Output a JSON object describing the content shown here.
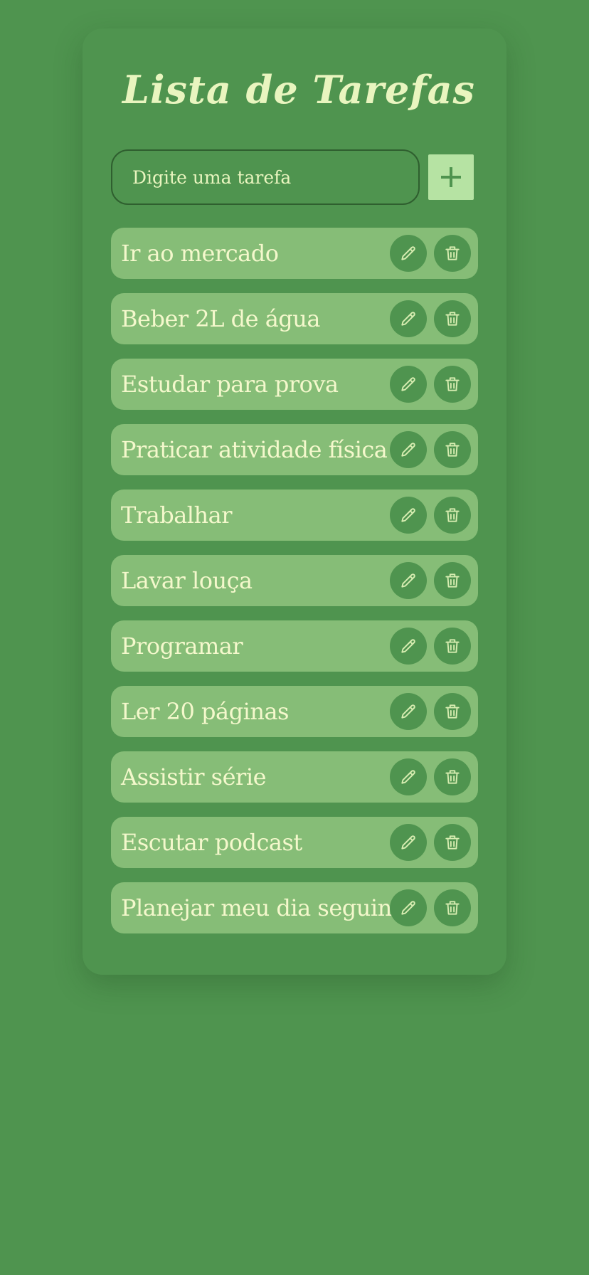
{
  "app": {
    "title": "Lista de Tarefas"
  },
  "input": {
    "placeholder": "Digite uma tarefa",
    "value": ""
  },
  "add_button": {
    "icon": "plus-icon"
  },
  "colors": {
    "background": "#4f944f",
    "task_item": "#86bd77",
    "text": "#e9f5bf",
    "add_button": "#b6e3a3"
  },
  "tasks": [
    {
      "label": "Ir ao mercado"
    },
    {
      "label": "Beber 2L de água"
    },
    {
      "label": "Estudar para prova"
    },
    {
      "label": "Praticar atividade física"
    },
    {
      "label": "Trabalhar"
    },
    {
      "label": "Lavar louça"
    },
    {
      "label": "Programar"
    },
    {
      "label": "Ler 20 páginas"
    },
    {
      "label": "Assistir série"
    },
    {
      "label": "Escutar podcast"
    },
    {
      "label": "Planejar meu dia seguinte"
    }
  ],
  "task_actions": {
    "edit_icon": "pencil-icon",
    "delete_icon": "trash-icon"
  }
}
